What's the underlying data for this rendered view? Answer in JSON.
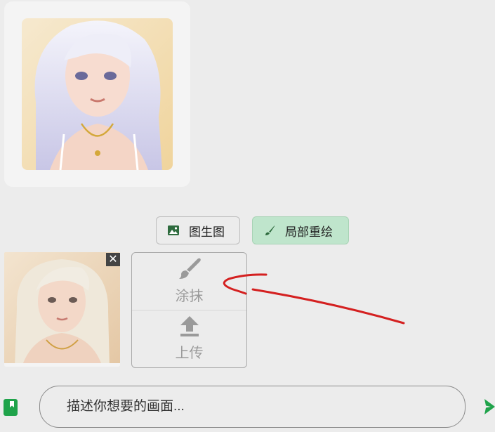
{
  "mode_buttons": {
    "img2img_label": "图生图",
    "inpaint_label": "局部重绘"
  },
  "reference": {
    "close_label": "✕"
  },
  "actions": {
    "smear_label": "涂抹",
    "upload_label": "上传"
  },
  "prompt": {
    "placeholder": "描述你想要的画面..."
  },
  "colors": {
    "accent_green": "#1fa34a",
    "inpaint_active_bg": "#bfe5cc",
    "annotation_red": "#d42020"
  },
  "icons": {
    "img2img": "image-icon",
    "inpaint": "brush-icon",
    "smear": "brush-icon",
    "upload": "upload-icon",
    "prompt_library": "bookmark-book-icon",
    "send": "send-icon"
  }
}
